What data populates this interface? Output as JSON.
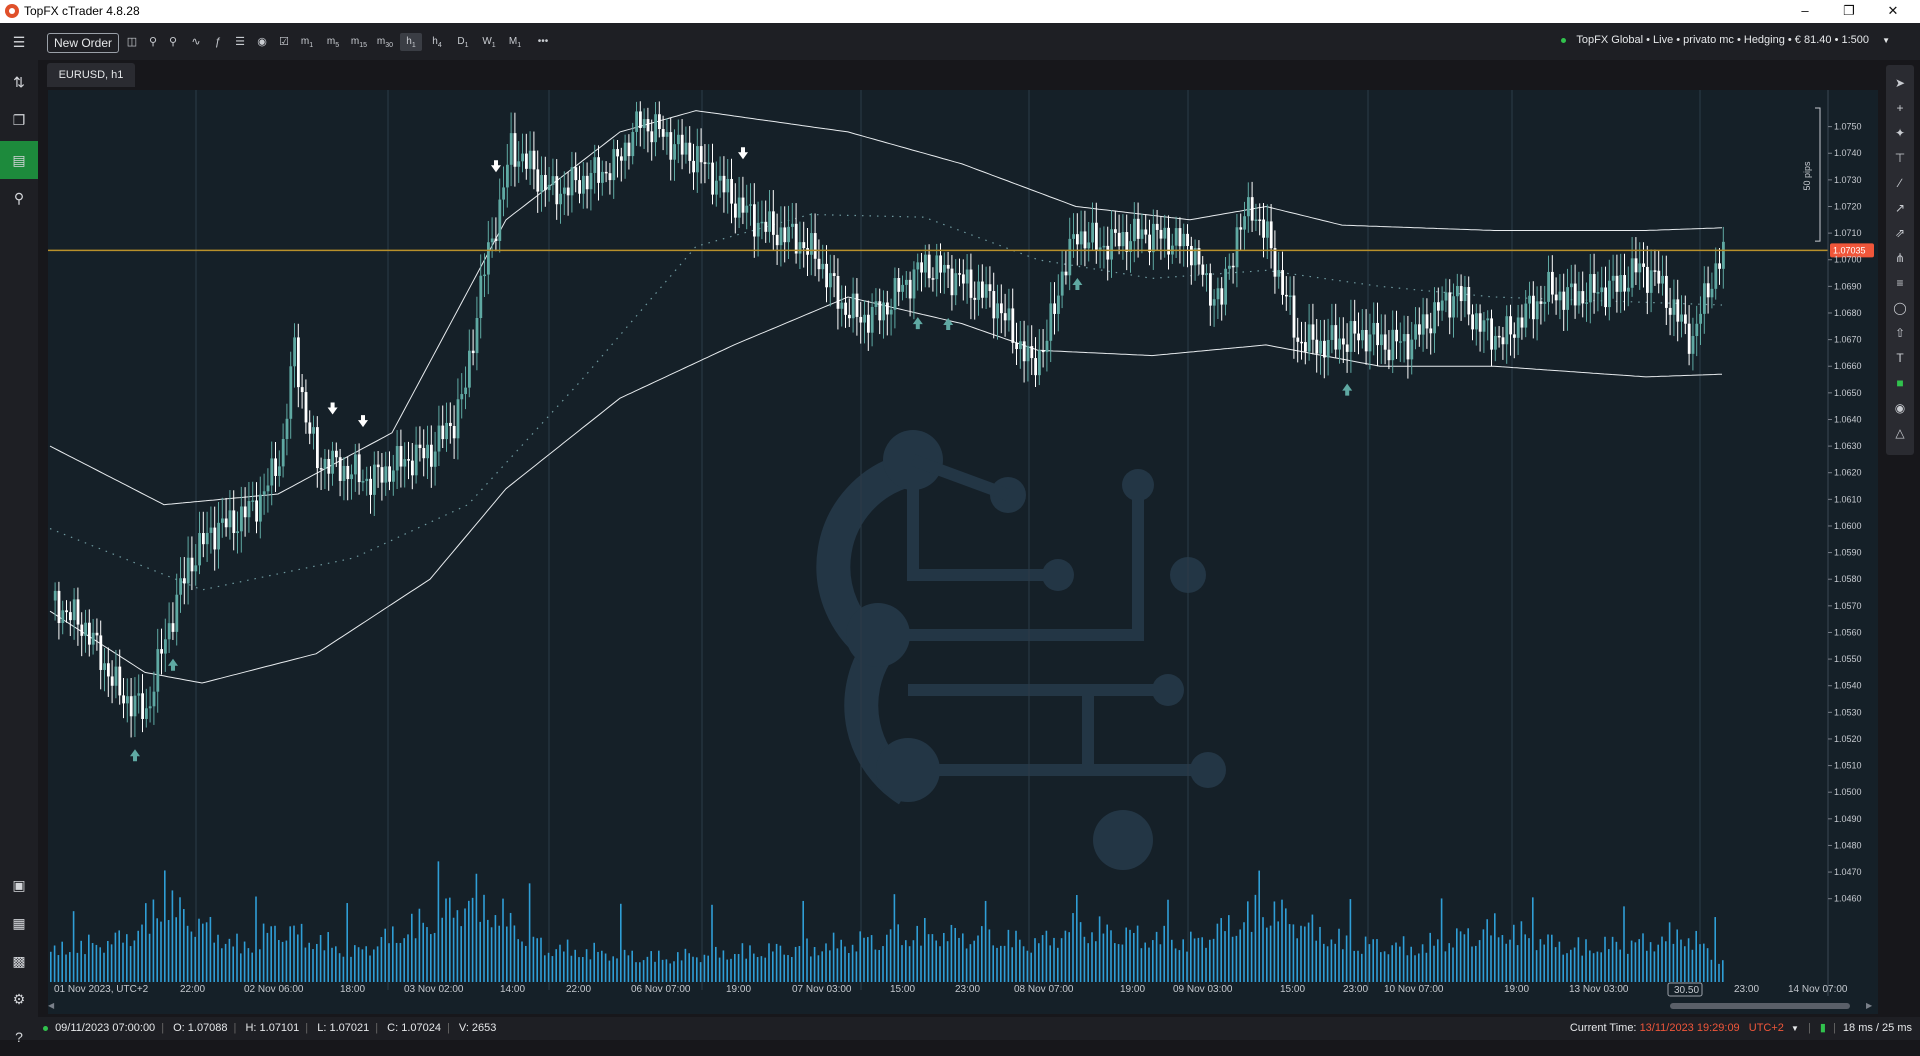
{
  "window": {
    "title": "TopFX cTrader 4.8.28"
  },
  "toolbar": {
    "new_order": "New Order",
    "timeframes": [
      {
        "main": "m",
        "sub": "1"
      },
      {
        "main": "m",
        "sub": "5"
      },
      {
        "main": "m",
        "sub": "15"
      },
      {
        "main": "m",
        "sub": "30"
      },
      {
        "main": "h",
        "sub": "1"
      },
      {
        "main": "h",
        "sub": "4"
      },
      {
        "main": "D",
        "sub": "1"
      },
      {
        "main": "W",
        "sub": "1"
      },
      {
        "main": "M",
        "sub": "1"
      }
    ],
    "more": "•••",
    "account": "TopFX Global • Live • privato mc • Hedging • € 81.40 • 1:500"
  },
  "tab": {
    "label": "EURUSD, h1"
  },
  "chart": {
    "price_labels": [
      "1.0750",
      "1.0740",
      "1.0730",
      "1.0720",
      "1.0710",
      "1.0700",
      "1.0690",
      "1.0680",
      "1.0670",
      "1.0660",
      "1.0650",
      "1.0640",
      "1.0630",
      "1.0620",
      "1.0610",
      "1.0600",
      "1.0590",
      "1.0580",
      "1.0570",
      "1.0560",
      "1.0550",
      "1.0540",
      "1.0530",
      "1.0520",
      "1.0510",
      "1.0500",
      "1.0490",
      "1.0480",
      "1.0470",
      "1.0460"
    ],
    "current_price": "1.07035",
    "measure_label": "50 pips",
    "time_labels": [
      "01 Nov 2023, UTC+2",
      "22:00",
      "02 Nov 06:00",
      "18:00",
      "03 Nov 02:00",
      "14:00",
      "22:00",
      "06 Nov 07:00",
      "19:00",
      "07 Nov 03:00",
      "15:00",
      "23:00",
      "08 Nov 07:00",
      "19:00",
      "09 Nov 03:00",
      "15:00",
      "23:00",
      "10 Nov 07:00",
      "19:00",
      "13 Nov 03:00",
      "15:00",
      "23:00",
      "14 Nov 07:00"
    ],
    "cursor_time": "30.50"
  },
  "status": {
    "time": "09/11/2023 07:00:00",
    "open": "O: 1.07088",
    "high": "H: 1.07101",
    "low": "L: 1.07021",
    "close": "C: 1.07024",
    "volume": "V: 2653",
    "current_time_label": "Current Time:",
    "current_time": "13/11/2023 19:29:09",
    "tz": "UTC+2",
    "latency": "18 ms / 25 ms"
  },
  "colors": {
    "bull": "#5fa9a3",
    "bear": "#ffffff",
    "volume": "#2f9ed6",
    "price_line": "#b8902b",
    "price_badge": "#f0563a",
    "active_nav": "#1d8a3c"
  },
  "chart_data": {
    "type": "candlestick",
    "symbol": "EURUSD",
    "timeframe": "h1",
    "ylim": [
      1.0455,
      1.076
    ],
    "current_price": 1.07035,
    "grid": "vertical",
    "anchors": [
      [
        0,
        1.0572
      ],
      [
        9,
        1.0562
      ],
      [
        18,
        1.0537
      ],
      [
        25,
        1.053
      ],
      [
        30,
        1.0558
      ],
      [
        36,
        1.0585
      ],
      [
        42,
        1.0598
      ],
      [
        50,
        1.0603
      ],
      [
        56,
        1.0612
      ],
      [
        61,
        1.063
      ],
      [
        64,
        1.0668
      ],
      [
        67,
        1.064
      ],
      [
        70,
        1.0625
      ],
      [
        76,
        1.0622
      ],
      [
        84,
        1.0617
      ],
      [
        92,
        1.0624
      ],
      [
        100,
        1.0628
      ],
      [
        106,
        1.064
      ],
      [
        109,
        1.0652
      ],
      [
        113,
        1.069
      ],
      [
        118,
        1.072
      ],
      [
        121,
        1.0742
      ],
      [
        126,
        1.0735
      ],
      [
        132,
        1.0725
      ],
      [
        140,
        1.073
      ],
      [
        148,
        1.0735
      ],
      [
        155,
        1.0752
      ],
      [
        160,
        1.0748
      ],
      [
        165,
        1.0742
      ],
      [
        170,
        1.0738
      ],
      [
        175,
        1.073
      ],
      [
        181,
        1.072
      ],
      [
        188,
        1.0712
      ],
      [
        196,
        1.0708
      ],
      [
        202,
        1.07
      ],
      [
        208,
        1.0683
      ],
      [
        213,
        1.0678
      ],
      [
        218,
        1.068
      ],
      [
        224,
        1.069
      ],
      [
        230,
        1.0698
      ],
      [
        236,
        1.0695
      ],
      [
        242,
        1.069
      ],
      [
        248,
        1.0685
      ],
      [
        254,
        1.067
      ],
      [
        258,
        1.066
      ],
      [
        262,
        1.067
      ],
      [
        266,
        1.0695
      ],
      [
        270,
        1.071
      ],
      [
        276,
        1.0705
      ],
      [
        282,
        1.0708
      ],
      [
        288,
        1.071
      ],
      [
        294,
        1.0708
      ],
      [
        300,
        1.0705
      ],
      [
        304,
        1.069
      ],
      [
        308,
        1.0685
      ],
      [
        312,
        1.071
      ],
      [
        316,
        1.072
      ],
      [
        320,
        1.0708
      ],
      [
        324,
        1.069
      ],
      [
        328,
        1.067
      ],
      [
        334,
        1.0668
      ],
      [
        340,
        1.067
      ],
      [
        346,
        1.0672
      ],
      [
        352,
        1.0668
      ],
      [
        358,
        1.067
      ],
      [
        364,
        1.068
      ],
      [
        370,
        1.0688
      ],
      [
        376,
        1.0675
      ],
      [
        382,
        1.067
      ],
      [
        388,
        1.068
      ],
      [
        394,
        1.0688
      ],
      [
        400,
        1.0686
      ],
      [
        406,
        1.0688
      ],
      [
        412,
        1.069
      ],
      [
        418,
        1.0697
      ],
      [
        423,
        1.0692
      ],
      [
        428,
        1.0678
      ],
      [
        432,
        1.067
      ],
      [
        436,
        1.069
      ],
      [
        440,
        1.0702
      ]
    ],
    "volume_anchors": [
      [
        0,
        0.3
      ],
      [
        20,
        0.45
      ],
      [
        30,
        0.8
      ],
      [
        50,
        0.35
      ],
      [
        60,
        0.55
      ],
      [
        80,
        0.3
      ],
      [
        112,
        0.85
      ],
      [
        130,
        0.35
      ],
      [
        160,
        0.25
      ],
      [
        200,
        0.35
      ],
      [
        230,
        0.5
      ],
      [
        260,
        0.4
      ],
      [
        270,
        0.55
      ],
      [
        300,
        0.4
      ],
      [
        320,
        0.75
      ],
      [
        340,
        0.4
      ],
      [
        360,
        0.35
      ],
      [
        380,
        0.55
      ],
      [
        400,
        0.35
      ],
      [
        420,
        0.4
      ],
      [
        430,
        0.5
      ],
      [
        440,
        0.2
      ]
    ],
    "upper_band": [
      [
        0,
        1.063
      ],
      [
        30,
        1.0608
      ],
      [
        60,
        1.0612
      ],
      [
        90,
        1.0635
      ],
      [
        120,
        1.0715
      ],
      [
        150,
        1.0748
      ],
      [
        170,
        1.0756
      ],
      [
        210,
        1.0748
      ],
      [
        240,
        1.0736
      ],
      [
        270,
        1.072
      ],
      [
        300,
        1.0715
      ],
      [
        320,
        1.072
      ],
      [
        340,
        1.0713
      ],
      [
        380,
        1.0711
      ],
      [
        420,
        1.0711
      ],
      [
        440,
        1.0712
      ]
    ],
    "lower_band": [
      [
        0,
        1.0568
      ],
      [
        25,
        1.0545
      ],
      [
        40,
        1.0541
      ],
      [
        70,
        1.0552
      ],
      [
        100,
        1.058
      ],
      [
        120,
        1.0614
      ],
      [
        150,
        1.0648
      ],
      [
        180,
        1.0668
      ],
      [
        210,
        1.0686
      ],
      [
        240,
        1.0676
      ],
      [
        260,
        1.0666
      ],
      [
        290,
        1.0664
      ],
      [
        320,
        1.0668
      ],
      [
        350,
        1.066
      ],
      [
        380,
        1.066
      ],
      [
        420,
        1.0656
      ],
      [
        440,
        1.0657
      ]
    ],
    "mid_band": [
      [
        0,
        1.0599
      ],
      [
        40,
        1.0576
      ],
      [
        80,
        1.0588
      ],
      [
        110,
        1.0608
      ],
      [
        140,
        1.0655
      ],
      [
        170,
        1.0705
      ],
      [
        200,
        1.0717
      ],
      [
        230,
        1.0716
      ],
      [
        260,
        1.07
      ],
      [
        290,
        1.0693
      ],
      [
        320,
        1.0696
      ],
      [
        350,
        1.069
      ],
      [
        380,
        1.0686
      ],
      [
        420,
        1.0684
      ],
      [
        440,
        1.0683
      ]
    ],
    "signals": [
      {
        "i": 22,
        "dir": "up"
      },
      {
        "i": 32,
        "dir": "up"
      },
      {
        "i": 74,
        "dir": "down"
      },
      {
        "i": 82,
        "dir": "down"
      },
      {
        "i": 117,
        "dir": "down"
      },
      {
        "i": 182,
        "dir": "down"
      },
      {
        "i": 228,
        "dir": "up"
      },
      {
        "i": 236,
        "dir": "up"
      },
      {
        "i": 270,
        "dir": "up"
      },
      {
        "i": 341,
        "dir": "up"
      }
    ]
  }
}
